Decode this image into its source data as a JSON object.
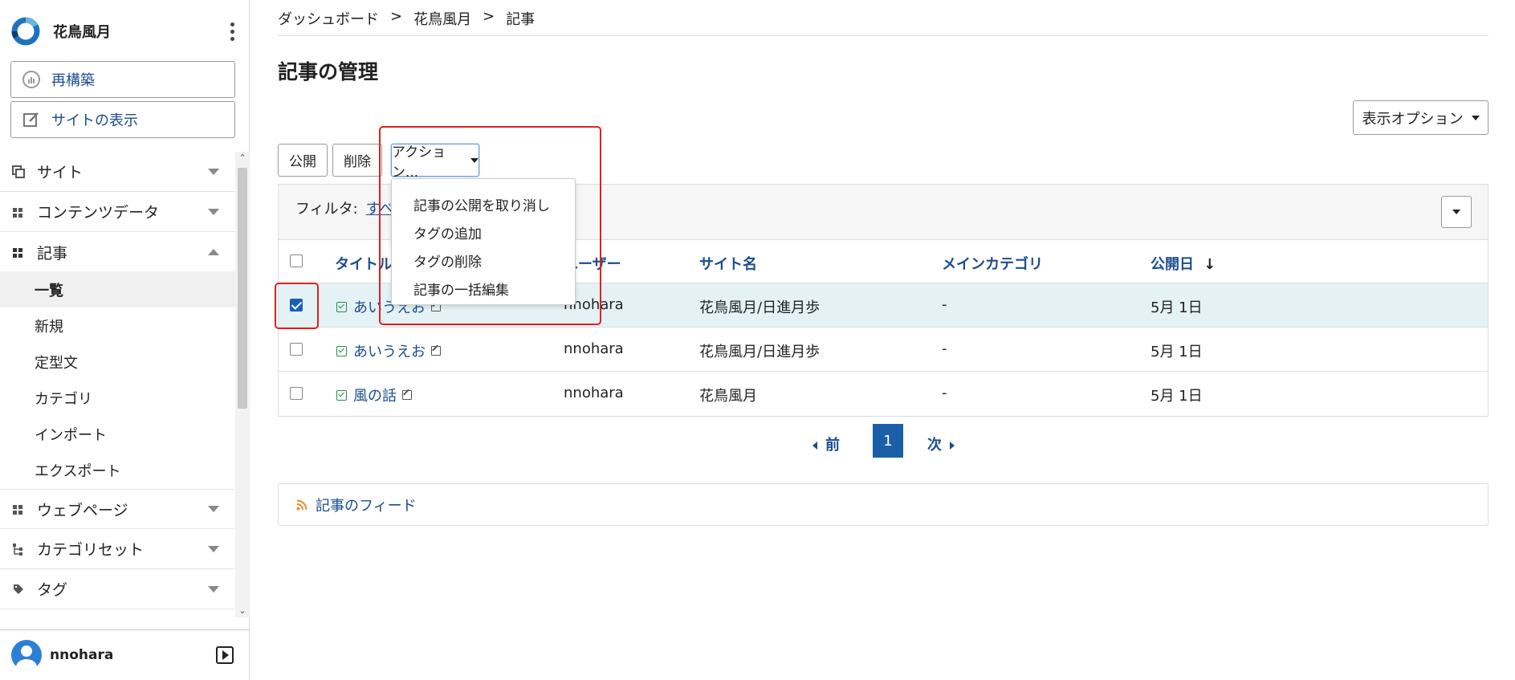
{
  "brand": {
    "name": "花鳥風月"
  },
  "sidebar": {
    "rebuild_label": "再構築",
    "view_site_label": "サイトの表示",
    "sections": [
      {
        "label": "サイト"
      },
      {
        "label": "コンテンツデータ"
      },
      {
        "label": "記事"
      },
      {
        "label": "ウェブページ"
      },
      {
        "label": "カテゴリセット"
      },
      {
        "label": "タグ"
      }
    ],
    "article_items": [
      {
        "label": "一覧"
      },
      {
        "label": "新規"
      },
      {
        "label": "定型文"
      },
      {
        "label": "カテゴリ"
      },
      {
        "label": "インポート"
      },
      {
        "label": "エクスポート"
      }
    ],
    "user": "nnohara"
  },
  "breadcrumb": [
    "ダッシュボード",
    "花鳥風月",
    "記事"
  ],
  "breadcrumb_sep": ">",
  "page_title": "記事の管理",
  "display_options_label": "表示オプション",
  "toolbar": {
    "publish_label": "公開",
    "delete_label": "削除",
    "actions_label": "アクション..."
  },
  "actions_menu": [
    "記事の公開を取り消し",
    "タグの追加",
    "タグの削除",
    "記事の一括編集"
  ],
  "filter": {
    "label": "フィルタ:",
    "value": "すべ"
  },
  "table": {
    "columns": [
      "タイトル",
      "ユーザー",
      "サイト名",
      "メインカテゴリ",
      "公開日"
    ],
    "sort_indicator": "↓",
    "rows": [
      {
        "title": "あいうえお",
        "user": "nnohara",
        "site": "花鳥風月/日進月歩",
        "category": "-",
        "date": "5月 1日",
        "checked": true
      },
      {
        "title": "あいうえお",
        "user": "nnohara",
        "site": "花鳥風月/日進月歩",
        "category": "-",
        "date": "5月 1日",
        "checked": false
      },
      {
        "title": "風の話",
        "user": "nnohara",
        "site": "花鳥風月",
        "category": "-",
        "date": "5月 1日",
        "checked": false
      }
    ]
  },
  "pagination": {
    "prev": "前",
    "current": "1",
    "next": "次"
  },
  "feed_label": "記事のフィード",
  "colors": {
    "link": "#1a4d8f",
    "accent": "#1a5fa8",
    "highlight": "#e02020",
    "selected_row": "#e5f2f5"
  }
}
